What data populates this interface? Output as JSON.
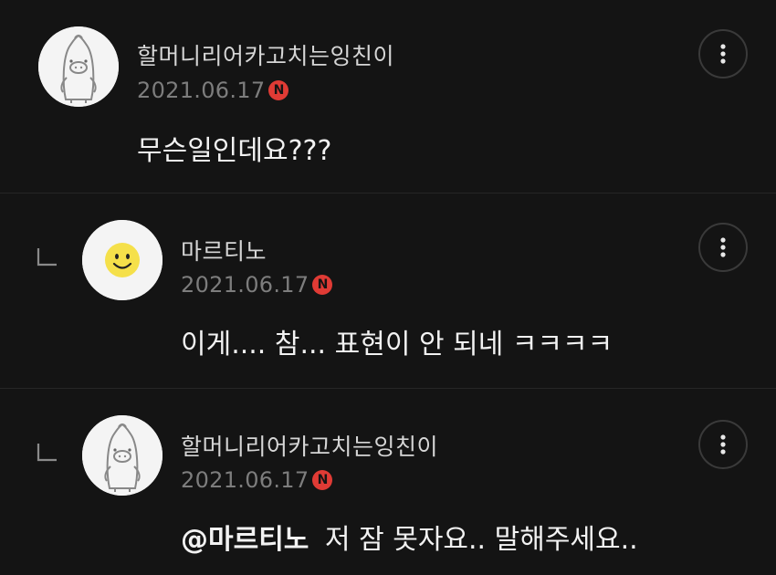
{
  "comments": [
    {
      "nickname": "할머니리어카고치는잉친이",
      "date": "2021.06.17",
      "badge": "N",
      "mention": "",
      "text": "무슨일인데요???",
      "avatar_icon": "penguin-avatar-icon",
      "is_reply": false
    },
    {
      "nickname": "마르티노",
      "date": "2021.06.17",
      "badge": "N",
      "mention": "",
      "text": "이게.... 참... 표현이 안 되네 ㅋㅋㅋㅋ",
      "avatar_icon": "smiley-avatar-icon",
      "is_reply": true
    },
    {
      "nickname": "할머니리어카고치는잉친이",
      "date": "2021.06.17",
      "badge": "N",
      "mention": "@마르티노",
      "text": "저 잠 못자요.. 말해주세요..",
      "avatar_icon": "penguin-avatar-icon",
      "is_reply": true
    }
  ],
  "colors": {
    "background": "#141414",
    "badge": "#e03b35",
    "smiley": "#f5e04a"
  }
}
